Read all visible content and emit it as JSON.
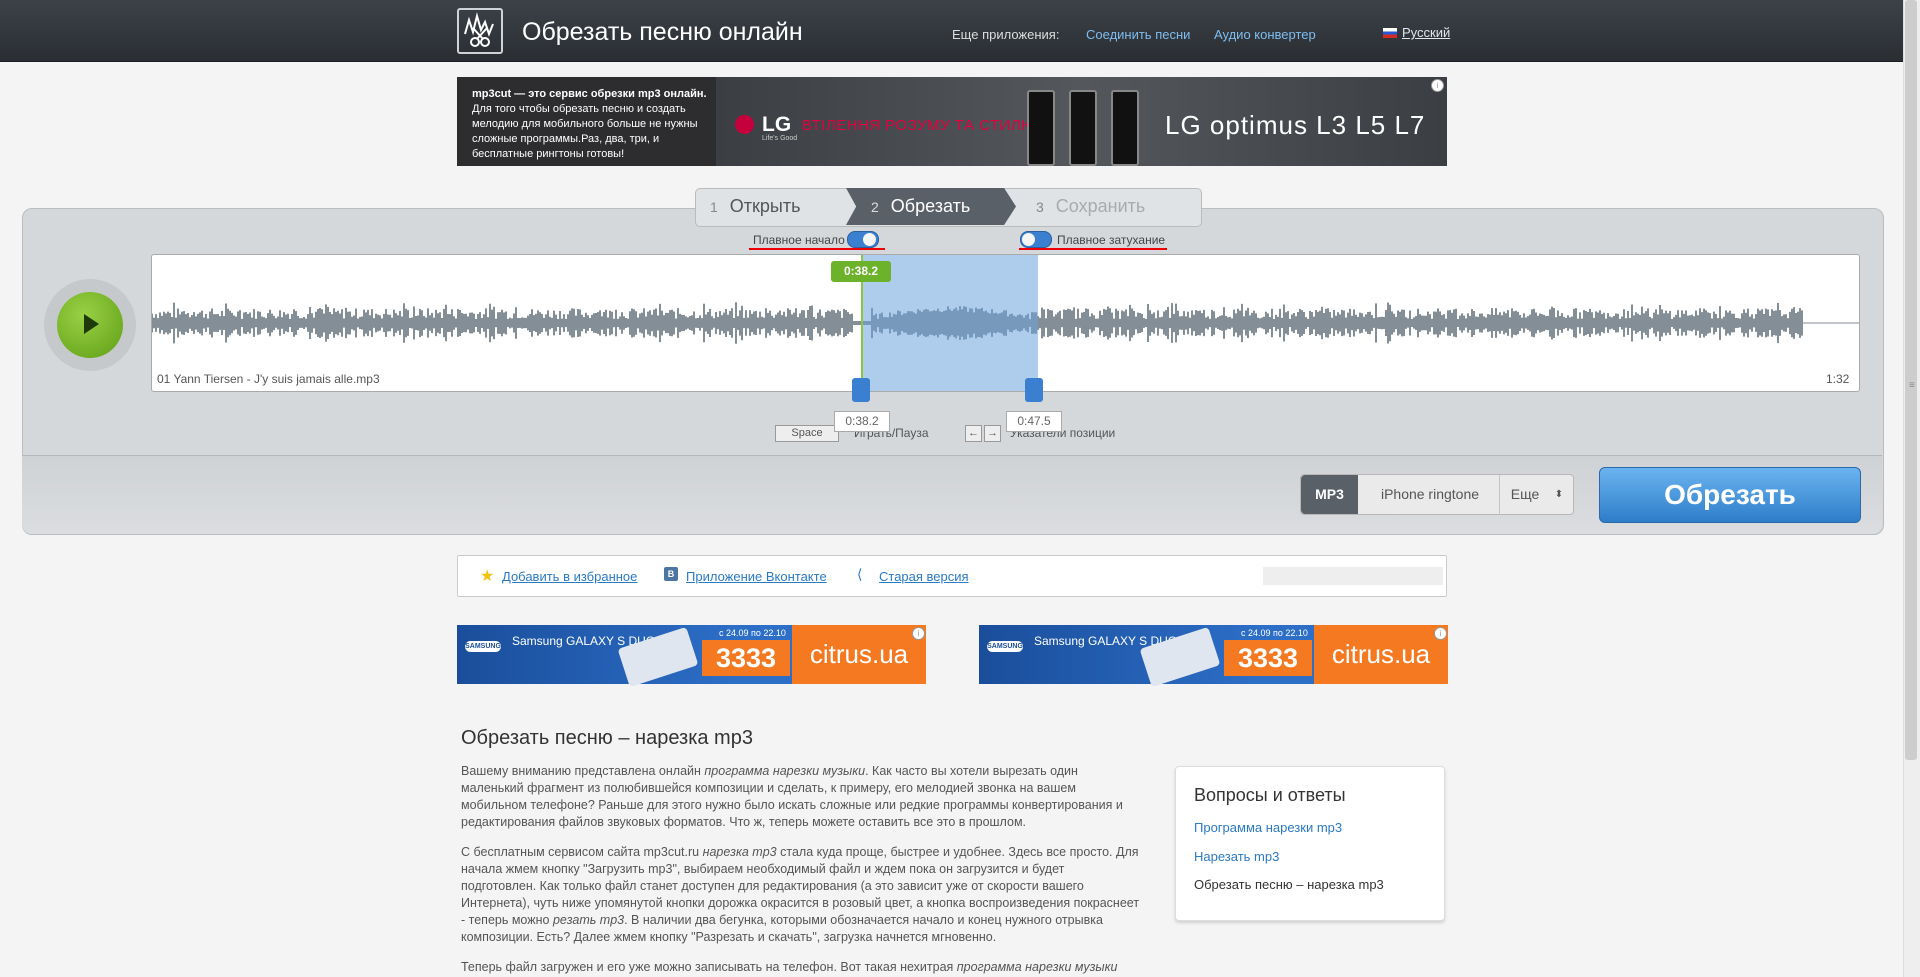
{
  "header": {
    "title": "Обрезать песню онлайн",
    "more_apps": "Еще приложения:",
    "link_join": "Соединить песни",
    "link_converter": "Аудио конвертер",
    "language": "Русский"
  },
  "ad_top": {
    "text_bold": "mp3cut — это сервис обрезки mp3 онлайн.",
    "text_rest": " Для того чтобы обрезать песню и создать мелодию для мобильного больше не нужны сложные программы.Раз, два, три, и бесплатные рингтоны готовы!",
    "lg_brand": "LG",
    "lg_tagline": "Life's Good",
    "slogan": "ВТІЛЕННЯ РОЗУМУ ТА СТИЛЮ",
    "product": "LG optimus L3 L5 L7"
  },
  "steps": [
    {
      "num": "1",
      "label": "Открыть"
    },
    {
      "num": "2",
      "label": "Обрезать"
    },
    {
      "num": "3",
      "label": "Сохранить"
    }
  ],
  "toggles": {
    "fade_in": "Плавное начало",
    "fade_out": "Плавное затухание"
  },
  "track": {
    "filename": "01 Yann Tiersen - J'y suis jamais alle.mp3",
    "duration": "1:32",
    "position_tag": "0:38.2",
    "start_time": "0:38.2",
    "end_time": "0:47.5"
  },
  "shortcuts": {
    "space_key": "Space",
    "play_pause": "Играть/Пауза",
    "left_key": "←",
    "right_key": "→",
    "position_pointers": "Указатели позиции"
  },
  "formats": {
    "mp3": "MP3",
    "iphone": "iPhone ringtone",
    "more": "Еще",
    "cut_button": "Обрезать"
  },
  "links": {
    "favorites": "Добавить в избранное",
    "vk": "Приложение Вконтакте",
    "old_version": "Старая версия"
  },
  "banner": {
    "samsung": "SAMSUNG",
    "galaxy": "Samsung GALAXY S DUOS",
    "dates": "с 24.09 по 22.10",
    "price": "3333",
    "shop": "citrus.ua"
  },
  "content": {
    "heading": "Обрезать песню – нарезка mp3",
    "p1_a": "Вашему вниманию представлена онлайн ",
    "p1_i": "программа нарезки музыки",
    "p1_b": ". Как часто вы хотели вырезать один маленький фрагмент из полюбившейся композиции и сделать, к примеру, его мелодией звонка на вашем мобильном телефоне? Раньше для этого нужно было искать сложные или редкие программы конвертирования и редактирования файлов звуковых форматов. Что ж, теперь можете оставить все это в прошлом.",
    "p2_a": "С бесплатным сервисом сайта mp3cut.ru ",
    "p2_i": "нарезка mp3",
    "p2_b": " стала куда проще, быстрее и удобнее. Здесь все просто. Для начала жмем кнопку \"Загрузить mp3\", выбираем необходимый файл и ждем пока он загрузится и будет подготовлен. Как только файл станет доступен для редактирования (а это зависит уже от скорости вашего Интернета), чуть ниже упомянутой кнопки дорожка окрасится в розовый цвет, а кнопка воспроизведения покраснеет - теперь можно ",
    "p2_i2": "резать mp3",
    "p2_c": ". В наличии два бегунка, которыми обозначается начало и конец нужного отрывка композиции. Есть? Далее жмем кнопку \"Разрезать и скачать\", загрузка начнется мгновенно.",
    "p3_a": "Теперь файл загружен и его уже можно записывать на телефон. Вот такая нехитрая ",
    "p3_i": "программа нарезки музыки"
  },
  "faq": {
    "title": "Вопросы и ответы",
    "items": [
      "Программа нарезки mp3",
      "Нарезать mp3",
      "Обрезать песню – нарезка mp3"
    ]
  },
  "colors": {
    "accent": "#3b7fd0",
    "play": "#7ab82b",
    "selection": "#6ca3db",
    "header": "#33373c"
  }
}
